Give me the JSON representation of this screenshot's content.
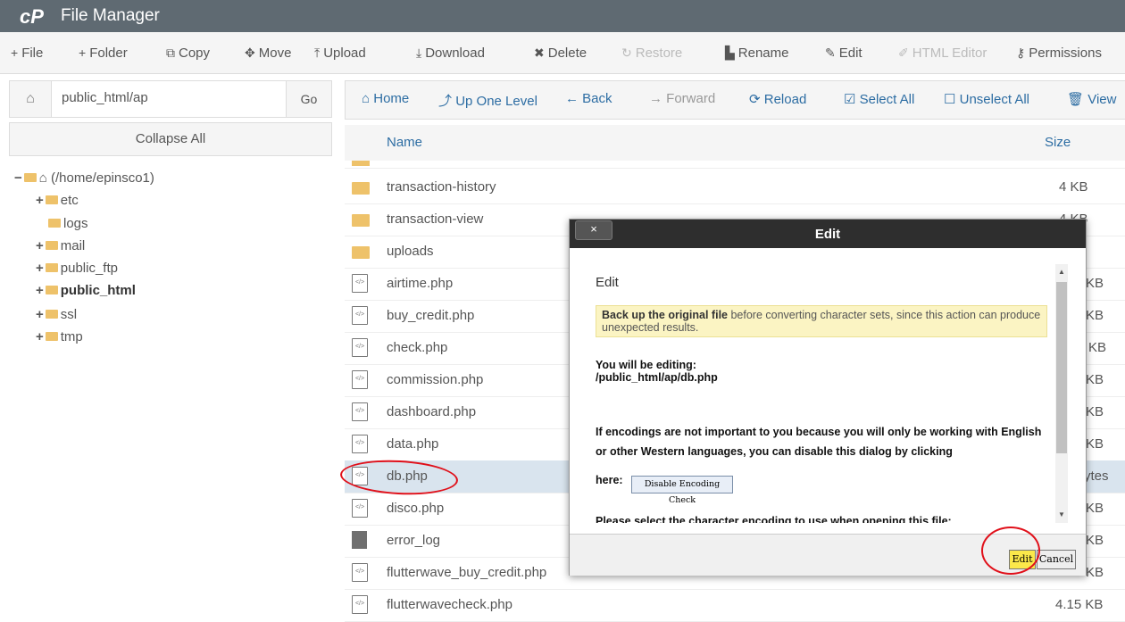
{
  "app": {
    "logo": "cP",
    "title": "File Manager"
  },
  "toolbar": {
    "file": "File",
    "folder": "Folder",
    "copy": "Copy",
    "move": "Move",
    "upload": "Upload",
    "download": "Download",
    "delete": "Delete",
    "restore": "Restore",
    "rename": "Rename",
    "edit": "Edit",
    "html_editor": "HTML Editor",
    "permissions": "Permissions"
  },
  "pathbar": {
    "value": "public_html/ap",
    "go": "Go"
  },
  "collapse_all": "Collapse All",
  "tree": {
    "root": "(/home/epinsco1)",
    "items": [
      "etc",
      "logs",
      "mail",
      "public_ftp",
      "public_html",
      "ssl",
      "tmp"
    ]
  },
  "nav": {
    "home": "Home",
    "up": "Up One Level",
    "back": "Back",
    "forward": "Forward",
    "reload": "Reload",
    "select_all": "Select All",
    "unselect_all": "Unselect All",
    "view": "View"
  },
  "list": {
    "col_name": "Name",
    "col_size": "Size",
    "rows": [
      {
        "name": "transaction-history",
        "size": "4 KB"
      },
      {
        "name": "transaction-view",
        "size": "4 KB"
      },
      {
        "name": "uploads",
        "size": ""
      },
      {
        "name": "airtime.php",
        "size": "KB"
      },
      {
        "name": "buy_credit.php",
        "size": "KB"
      },
      {
        "name": "check.php",
        "size": "KB"
      },
      {
        "name": "commission.php",
        "size": "KB"
      },
      {
        "name": "dashboard.php",
        "size": "KB"
      },
      {
        "name": "data.php",
        "size": "KB"
      },
      {
        "name": "db.php",
        "size": "ytes"
      },
      {
        "name": "disco.php",
        "size": "KB"
      },
      {
        "name": "error_log",
        "size": "KB"
      },
      {
        "name": "flutterwave_buy_credit.php",
        "size": "KB"
      },
      {
        "name": "flutterwavecheck.php",
        "size": "4.15 KB"
      }
    ]
  },
  "dialog": {
    "title": "Edit",
    "close": "×",
    "heading": "Edit",
    "warn_bold": "Back up the original file",
    "warn_rest": " before converting character sets, since this action can produce unexpected results.",
    "editing_label": "You will be editing:",
    "editing_path": "/public_html/ap/db.php",
    "encoding_text": "If encodings are not important to you because you will only be working with English or other Western languages, you can disable this dialog by clicking",
    "here": "here:",
    "disable_btn": "Disable Encoding Check",
    "cutoff": "Please select the character encoding to use when opening this file:",
    "edit_btn": "Edit",
    "cancel_btn": "Cancel"
  }
}
